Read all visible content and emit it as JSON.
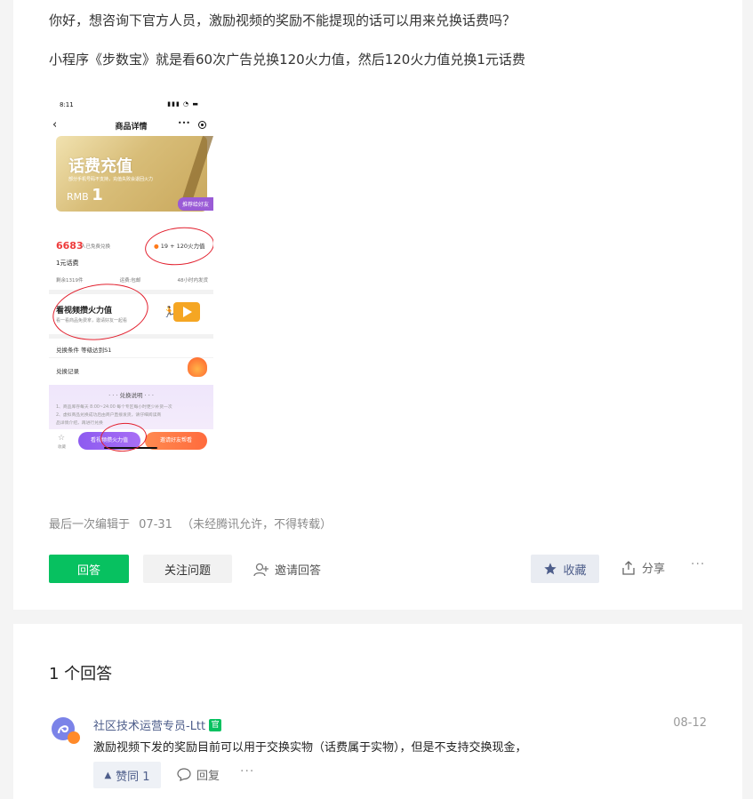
{
  "question": {
    "line1": "你好，想咨询下官方人员，激励视频的奖励不能提现的话可以用来兑换话费吗？",
    "line2": "小程序《步数宝》就是看60次广告兑换120火力值，然后120火力值兑换1元话费"
  },
  "screenshot": {
    "status_time": "8:11",
    "nav_title": "商品详情",
    "gift_title": "话费充值",
    "gift_sub": "部分手机号码不支持，充值失败会退回火力",
    "gift_rmb": "RMB",
    "gift_amount": "1",
    "badge": "推荐给好友",
    "count": "6683",
    "count_label": "人已免费兑换",
    "fire_cost": "19 + 120火力值",
    "price_name": "1元话费",
    "stock": "剩余1319件",
    "shipping": "运费:包邮",
    "delivery": "48小时内发货",
    "video_title": "看视频攒火力值",
    "video_sub": "看一看商品免费拿，邀请好友一起看",
    "condition": "兑换条件   等级达到S1",
    "record": "兑换记录",
    "explain_title": "兑换说明",
    "explain_line1": "1、商品库存每天 8:00~24:00 每个专区每小时更少补货一次",
    "explain_line2": "2、虚拟商品兑换成功后由商户直接发货，请仔细阅读商",
    "explain_line3": "品详情介绍，再进行兑换",
    "fav_label": "收藏",
    "watch_btn": "看视频攒火力值",
    "invite_btn": "邀请好友帮看"
  },
  "meta": {
    "edited_label": "最后一次编辑于",
    "edited_date": "07-31",
    "notice": "（未经腾讯允许，不得转载）"
  },
  "actions": {
    "answer": "回答",
    "follow": "关注问题",
    "invite": "邀请回答",
    "collect": "收藏",
    "share": "分享",
    "more": "···"
  },
  "answers": {
    "count_label": "1 个回答",
    "items": [
      {
        "author": "社区技术运营专员-Ltt",
        "badge": "官",
        "date": "08-12",
        "text": "激励视频下发的奖励目前可以用于交换实物（话费属于实物），但是不支持交换现金，",
        "like_label": "赞同 1",
        "reply_label": "回复",
        "more": "···"
      }
    ]
  },
  "colors": {
    "primary_green": "#07c160",
    "link_blue": "#4e5e8b",
    "annotation_red": "#e2202e"
  }
}
